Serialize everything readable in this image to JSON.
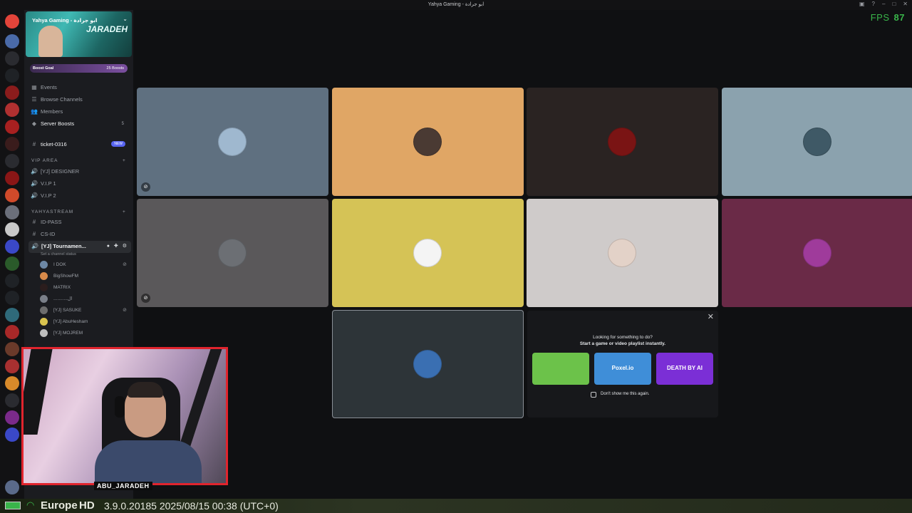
{
  "window": {
    "title": "Yahya Gaming - ابو جرادة",
    "fps_label": "FPS",
    "fps_value": "87"
  },
  "server": {
    "name": "Yahya Gaming - ابو جرادة",
    "banner_brand": "JARADEH",
    "boost_goal": "Boost Goal",
    "boost_count": "25 Boosts"
  },
  "sidebar": {
    "menu": [
      {
        "label": "Events",
        "icon": "calendar-icon"
      },
      {
        "label": "Browse Channels",
        "icon": "list-icon"
      },
      {
        "label": "Members",
        "icon": "members-icon"
      },
      {
        "label": "Server Boosts",
        "icon": "boost-icon",
        "count": "5"
      }
    ],
    "ticket": {
      "label": "ticket-0316",
      "pill": "NEW"
    },
    "vip_category": "VIP AREA",
    "vip_channels": [
      "[YJ] DESIGNER",
      "V.I.P 1",
      "V.I.P 2"
    ],
    "stream_category": "YAHYASTREAM",
    "text_channels": [
      "ID-PASS",
      "CS-ID"
    ],
    "voice_channel": "[YJ] Tournamen...",
    "status_hint": "Set a channel status",
    "members": [
      {
        "name": "I DOK",
        "color": "#6d88a6"
      },
      {
        "name": "BigShowFM",
        "color": "#d88a4a"
      },
      {
        "name": "MATRIX",
        "color": "#2b1d1d"
      },
      {
        "name": "...........ال",
        "color": "#7a7f88"
      },
      {
        "name": "[YJ] SASUKE",
        "color": "#6d6d6d"
      },
      {
        "name": "[YJ] AbuHesham",
        "color": "#d9c34f"
      },
      {
        "name": "[YJ] MOJREM",
        "color": "#bfbfbf"
      }
    ]
  },
  "tiles": [
    {
      "bg": "#5f7080",
      "avatar": "#9fb8cf",
      "muted": true
    },
    {
      "bg": "#e0a665",
      "avatar": "#4a3a33",
      "muted": false
    },
    {
      "bg": "#2a2322",
      "avatar": "#7a1414",
      "muted": false
    },
    {
      "bg": "#8ba2ae",
      "avatar": "#3f5966",
      "muted": false
    },
    {
      "bg": "#5a585a",
      "avatar": "#6c6f74",
      "muted": true
    },
    {
      "bg": "#d5c356",
      "avatar": "#f4f4f4",
      "muted": false
    },
    {
      "bg": "#cfcbca",
      "avatar": "#e3d2c8",
      "muted": false
    },
    {
      "bg": "#6a2a47",
      "avatar": "#9f3b9b",
      "muted": false
    },
    {
      "bg": "#2d3438",
      "avatar": "#3a6fb2",
      "muted": false
    }
  ],
  "activity": {
    "line1": "Looking for something to do?",
    "line2": "Start a game or video playlist instantly.",
    "games": [
      {
        "label": "",
        "color": "#6cc24a"
      },
      {
        "label": "Poxel.io",
        "color": "#3f8ed8"
      },
      {
        "label": "DEATH BY AI",
        "color": "#7b2fd6"
      }
    ],
    "dont_show": "Don't show me this again."
  },
  "webcam": {
    "label": "ABU_JARADEH"
  },
  "status_bar": {
    "region": "Europe",
    "quality": "HD",
    "version": "3.9.0.20185 2025/08/15 00:38 (UTC+0)"
  }
}
